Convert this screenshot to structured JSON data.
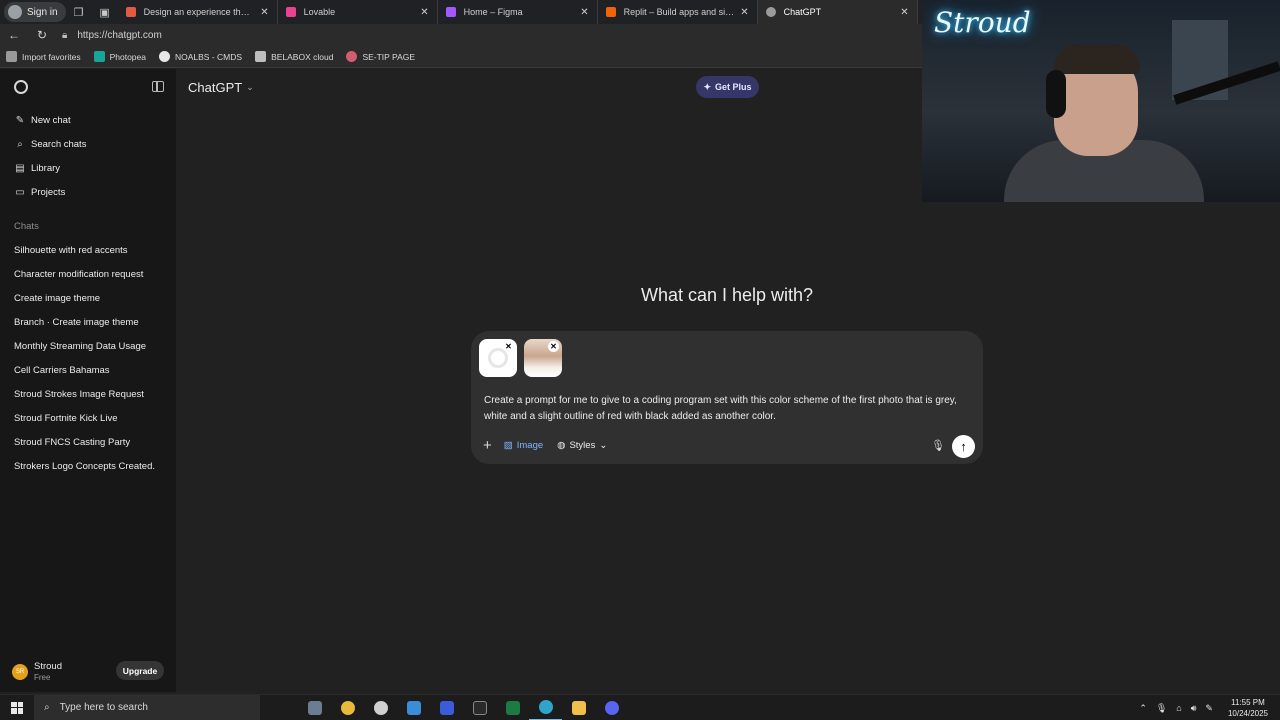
{
  "browser": {
    "profile_label": "Sign in",
    "tabs": [
      {
        "title": "Design an experience that transf",
        "color": "#e05b3f"
      },
      {
        "title": "Lovable",
        "color": "#e84393"
      },
      {
        "title": "Home – Figma",
        "color": "#a259ff"
      },
      {
        "title": "Replit – Build apps and sites with",
        "color": "#f26207"
      },
      {
        "title": "ChatGPT",
        "color": "#9b9b9b"
      }
    ],
    "url": "https://chatgpt.com",
    "bookmarks": [
      {
        "label": "Import favorites",
        "color": "#9a9a9a"
      },
      {
        "label": "Photopea",
        "color": "#18a497"
      },
      {
        "label": "NOALBS - CMDS",
        "color": "#e8e8e8"
      },
      {
        "label": "BELABOX cloud",
        "color": "#bdbdbd"
      },
      {
        "label": "SE-TIP PAGE",
        "color": "#d35d6e"
      }
    ]
  },
  "sidebar": {
    "nav": [
      {
        "label": "New chat",
        "icon": "edit-icon"
      },
      {
        "label": "Search chats",
        "icon": "search-icon"
      },
      {
        "label": "Library",
        "icon": "library-icon"
      },
      {
        "label": "Projects",
        "icon": "folder-icon"
      }
    ],
    "chats_heading": "Chats",
    "chats": [
      "Silhouette with red accents",
      "Character modification request",
      "Create image theme",
      "Branch · Create image theme",
      "Monthly Streaming Data Usage",
      "Cell Carriers Bahamas",
      "Stroud Strokes Image Request",
      "Stroud Fortnite Kick Live",
      "Stroud FNCS Casting Party",
      "Strokers Logo Concepts Created."
    ],
    "user": {
      "name": "Stroud",
      "plan": "Free",
      "initials": "SR"
    },
    "upgrade_label": "Upgrade"
  },
  "main": {
    "model_label": "ChatGPT",
    "get_plus_label": "Get Plus",
    "headline": "What can I help with?",
    "composer": {
      "text": "Create a prompt for me to give to a coding program set with this color scheme of the first photo that is grey, white and a slight outline of red with black added as another color.",
      "image_label": "Image",
      "styles_label": "Styles"
    }
  },
  "webcam": {
    "neon_text": "Stroud"
  },
  "taskbar": {
    "search_placeholder": "Type here to search",
    "apps": [
      {
        "name": "file-manager",
        "color": "#6b7c93"
      },
      {
        "name": "chrome",
        "color": "#e9b93b"
      },
      {
        "name": "chatgpt",
        "color": "#d0d0d0"
      },
      {
        "name": "store",
        "color": "#3c8dd9"
      },
      {
        "name": "notion-like",
        "color": "#3b5bdb"
      },
      {
        "name": "epic-games",
        "color": "#2a2a2a"
      },
      {
        "name": "excel",
        "color": "#1d7a45"
      },
      {
        "name": "edge",
        "color": "#2ea5c9"
      },
      {
        "name": "explorer",
        "color": "#f0c04a"
      },
      {
        "name": "discord-like",
        "color": "#5865f2"
      }
    ],
    "time": "11:55 PM",
    "date": "10/24/2025"
  },
  "colors": {
    "accent": "#7fb6ff",
    "get_plus_bg": "#373669",
    "sidebar_bg": "#171717",
    "main_bg": "#212121"
  }
}
